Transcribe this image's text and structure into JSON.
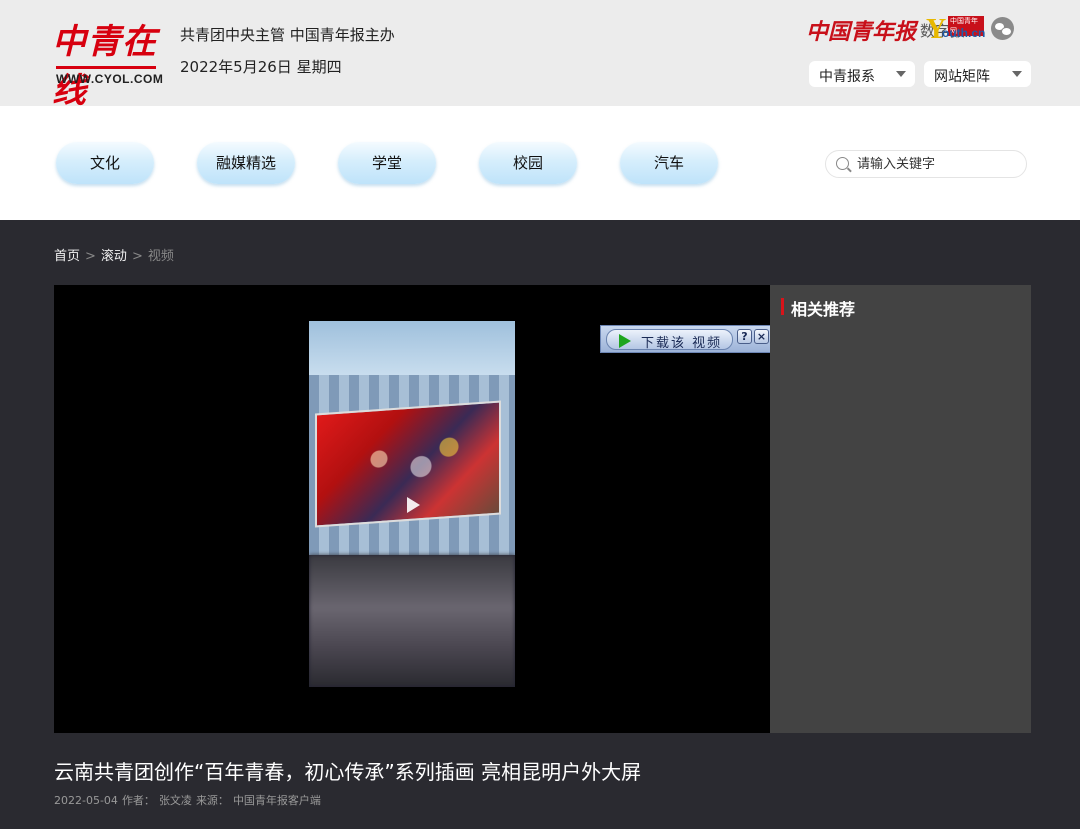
{
  "header": {
    "logo_cn": "中青在线",
    "logo_en": "WWW.CYOL.COM",
    "line1": "共青团中央主管 中国青年报主办",
    "date": "2022年5月26日 星期四",
    "digital_paper_red": "中国青年报",
    "digital_paper_grey": "数字报",
    "youth_logo": "Youth.cn",
    "youth_tag": "中国青年网",
    "select1": "中青报系",
    "select2": "网站矩阵"
  },
  "nav": {
    "items": [
      "文化",
      "融媒精选",
      "学堂",
      "校园",
      "汽车"
    ],
    "search_placeholder": "请输入关键字"
  },
  "breadcrumb": {
    "home": "首页",
    "section": "滚动",
    "current": "视频",
    "separator": ">"
  },
  "player": {
    "download_label": "下载该 视频",
    "help": "?",
    "close": "×"
  },
  "related": {
    "title": "相关推荐"
  },
  "article": {
    "title": "云南共青团创作“百年青春，初心传承”系列插画 亮相昆明户外大屏",
    "date": "2022-05-04",
    "author_label": "作者：",
    "author": "张文凌",
    "source_label": "来源：",
    "source": "中国青年报客户端"
  },
  "colors": {
    "brand_red": "#d7000f",
    "page_bg": "#2a2a30",
    "header_bg": "#ececec",
    "nav_pill": "#bfe3fa",
    "related_bg": "#434343"
  },
  "icons": [
    "search-icon",
    "wechat-icon",
    "play-icon",
    "caret-down-icon",
    "help-icon",
    "close-icon"
  ]
}
